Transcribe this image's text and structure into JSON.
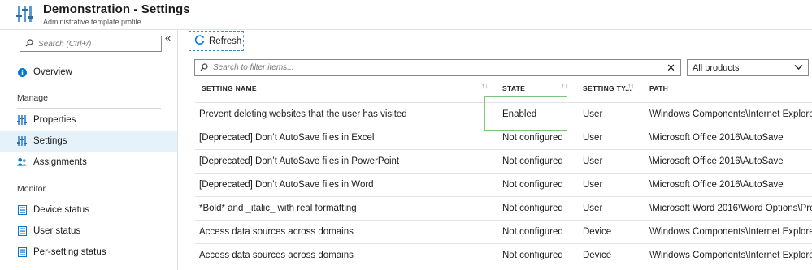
{
  "header": {
    "title": "Demonstration - Settings",
    "subtitle": "Administrative template profile",
    "logo_icon": "intune-settings-icon"
  },
  "sidebar": {
    "search_placeholder": "Search (Ctrl+/)",
    "collapse_glyph": "«",
    "items": [
      {
        "label": "Overview",
        "icon": "info-icon"
      },
      {
        "label": "Properties",
        "icon": "sliders-icon"
      },
      {
        "label": "Settings",
        "icon": "sliders-icon",
        "active": true
      },
      {
        "label": "Assignments",
        "icon": "users-icon"
      },
      {
        "label": "Device status",
        "icon": "list-icon"
      },
      {
        "label": "User status",
        "icon": "list-icon"
      },
      {
        "label": "Per-setting status",
        "icon": "list-icon"
      }
    ],
    "sections": {
      "manage": "Manage",
      "monitor": "Monitor"
    }
  },
  "toolbar": {
    "refresh_label": "Refresh"
  },
  "filter": {
    "placeholder": "Search to filter items...",
    "clear_glyph": "✕",
    "products_value": "All products"
  },
  "table": {
    "columns": [
      "SETTING NAME",
      "STATE",
      "SETTING TY...",
      "PATH"
    ],
    "rows": [
      [
        "Prevent deleting websites that the user has visited",
        "Enabled",
        "User",
        "\\Windows Components\\Internet Explore"
      ],
      [
        "[Deprecated] Don’t AutoSave files in Excel",
        "Not configured",
        "User",
        "\\Microsoft Office 2016\\AutoSave"
      ],
      [
        "[Deprecated] Don’t AutoSave files in PowerPoint",
        "Not configured",
        "User",
        "\\Microsoft Office 2016\\AutoSave"
      ],
      [
        "[Deprecated] Don’t AutoSave files in Word",
        "Not configured",
        "User",
        "\\Microsoft Office 2016\\AutoSave"
      ],
      [
        "*Bold* and _italic_ with real formatting",
        "Not configured",
        "User",
        "\\Microsoft Word 2016\\Word Options\\Pro"
      ],
      [
        "Access data sources across domains",
        "Not configured",
        "Device",
        "\\Windows Components\\Internet Explore"
      ],
      [
        "Access data sources across domains",
        "Not configured",
        "Device",
        "\\Windows Components\\Internet Explore"
      ]
    ]
  },
  "colors": {
    "accent": "#0078d4",
    "active_bg": "#e6f2fa",
    "highlight": "#7cc57c"
  }
}
